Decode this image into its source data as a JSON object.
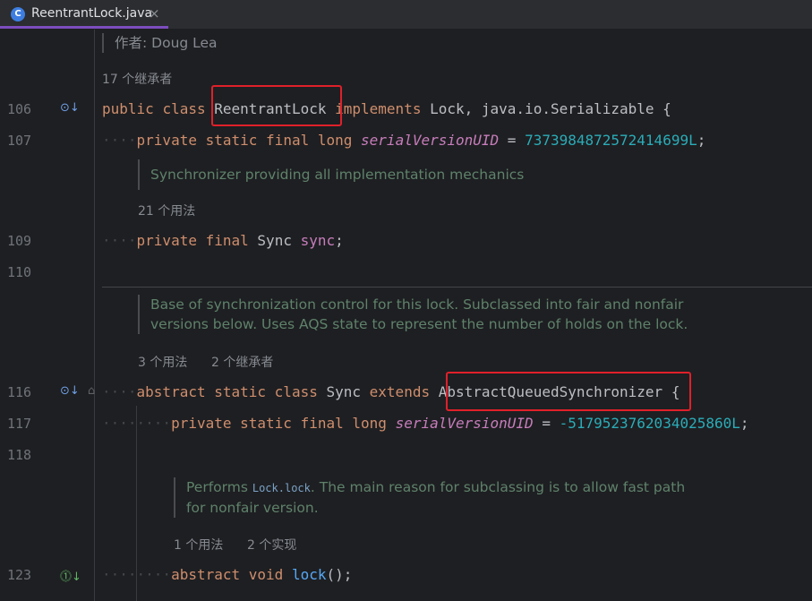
{
  "tab": {
    "title": "ReentrantLock.java",
    "icon_letter": "C",
    "close": "×"
  },
  "author_line": "作者: Doug Lea",
  "hints": {
    "h1": "17 个继承者",
    "h2": "21 个用法",
    "h3a": "3 个用法",
    "h3b": "2 个继承者",
    "h4a": "1 个用法",
    "h4b": "2 个实现"
  },
  "docs": {
    "sync_field": "Synchronizer providing all implementation mechanics",
    "sync_class_1": "Base of synchronization control for this lock. Subclassed into fair and nonfair",
    "sync_class_2": "versions below. Uses AQS state to represent the number of holds on the lock.",
    "lock_pre": "Performs ",
    "lock_code": "Lock.lock",
    "lock_post": ". The main reason for subclassing is to allow fast path",
    "lock_2": "for nonfair version."
  },
  "line_numbers": [
    "106",
    "107",
    "109",
    "110",
    "116",
    "117",
    "118",
    "123"
  ],
  "code": {
    "l106": {
      "public": "public",
      "class": "class",
      "name": "ReentrantLock",
      "implements": "implements",
      "rest": "Lock, java.io.Serializable {"
    },
    "l107": {
      "dots": "····",
      "private": "private",
      "static": "static",
      "final": "final",
      "long": "long",
      "field": "serialVersionUID",
      "eq": " = ",
      "value": "7373984872572414699L",
      "semi": ";"
    },
    "l109": {
      "dots": "····",
      "private": "private",
      "final": "final",
      "type": "Sync",
      "field": "sync",
      "semi": ";"
    },
    "l116": {
      "dots": "····",
      "abstract": "abstract",
      "static": "static",
      "class": "class",
      "name": "Sync",
      "extends": "extends",
      "parent": "AbstractQueuedSynchronizer",
      "brace": " {"
    },
    "l117": {
      "dots": "········",
      "private": "private",
      "static": "static",
      "final": "final",
      "long": "long",
      "field": "serialVersionUID",
      "eq": " = ",
      "value": "-5179523762034025860L",
      "semi": ";"
    },
    "l123": {
      "dots": "········",
      "abstract": "abstract",
      "void": "void",
      "method": "lock",
      "rest": "();"
    }
  },
  "colors": {
    "highlight_box": "#e0202a",
    "tab_underline": "#7c4dbe",
    "background": "#1e1f22"
  },
  "gutter_icons": [
    "overridden-method-icon",
    "implemented-icon",
    "fold-icon"
  ]
}
